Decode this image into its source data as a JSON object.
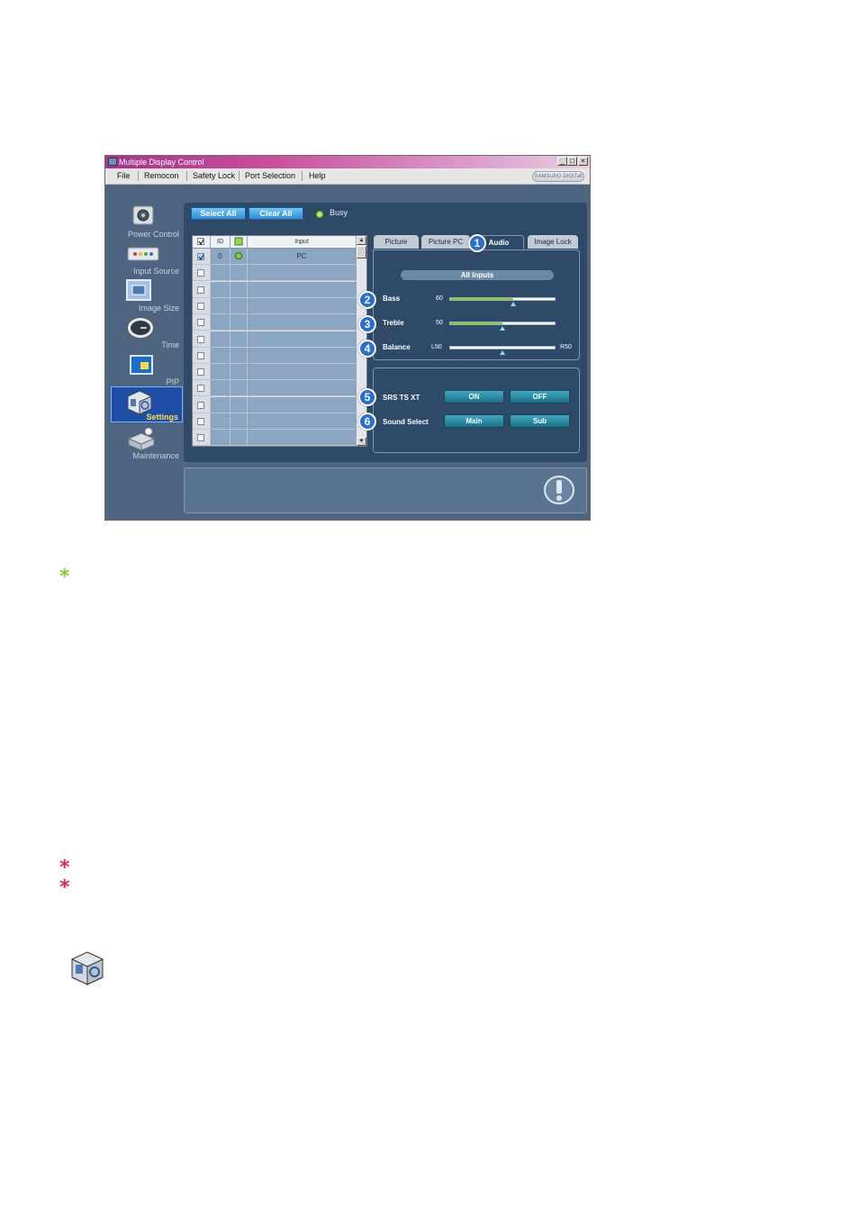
{
  "window": {
    "title": "Multiple Display Control",
    "brand": "SAMSUNG DIGITall",
    "min_glyph": "_",
    "max_glyph": "□",
    "close_glyph": "×"
  },
  "menu": [
    "File",
    "Remocon",
    "Safety Lock",
    "Port Selection",
    "Help"
  ],
  "nav": [
    {
      "label": "Power Control",
      "icon": "power-control-icon"
    },
    {
      "label": "Input Source",
      "icon": "input-source-icon"
    },
    {
      "label": "Image Size",
      "icon": "image-size-icon"
    },
    {
      "label": "Time",
      "icon": "clock-icon"
    },
    {
      "label": "PIP",
      "icon": "pip-icon"
    },
    {
      "label": "Settings",
      "icon": "settings-cube-icon",
      "selected": true
    },
    {
      "label": "Maintenance",
      "icon": "maintenance-icon"
    }
  ],
  "toolbar": {
    "select_all": "Select All",
    "clear_all": "Clear All",
    "busy": "Busy"
  },
  "grid": {
    "columns": [
      "ID",
      "Input"
    ],
    "rows": [
      {
        "id": "0",
        "input": "PC",
        "checked": true
      }
    ],
    "empty_rows": 11
  },
  "tabs": [
    "Picture",
    "Picture PC",
    "Audio",
    "Image Lock"
  ],
  "active_tab": "Audio",
  "audio": {
    "all_inputs": "All Inputs",
    "bass": {
      "label": "Bass",
      "value": "60",
      "level": 60
    },
    "treble": {
      "label": "Treble",
      "value": "50",
      "level": 50
    },
    "balance": {
      "label": "Balance",
      "left": "L50",
      "right": "R50",
      "level": 50
    }
  },
  "srs": {
    "label": "SRS TS XT",
    "on": "ON",
    "off": "OFF"
  },
  "sound_select": {
    "label": "Sound Select",
    "main": "Main",
    "sub": "Sub"
  },
  "badges": [
    "1",
    "2",
    "3",
    "4",
    "5",
    "6"
  ],
  "colors": {
    "note_star": "#8cc63f",
    "warn_star": "#e0226e",
    "accent": "#2a6fd0"
  },
  "page_marks": {
    "note": "*",
    "warn1": "*",
    "warn2": "*"
  }
}
